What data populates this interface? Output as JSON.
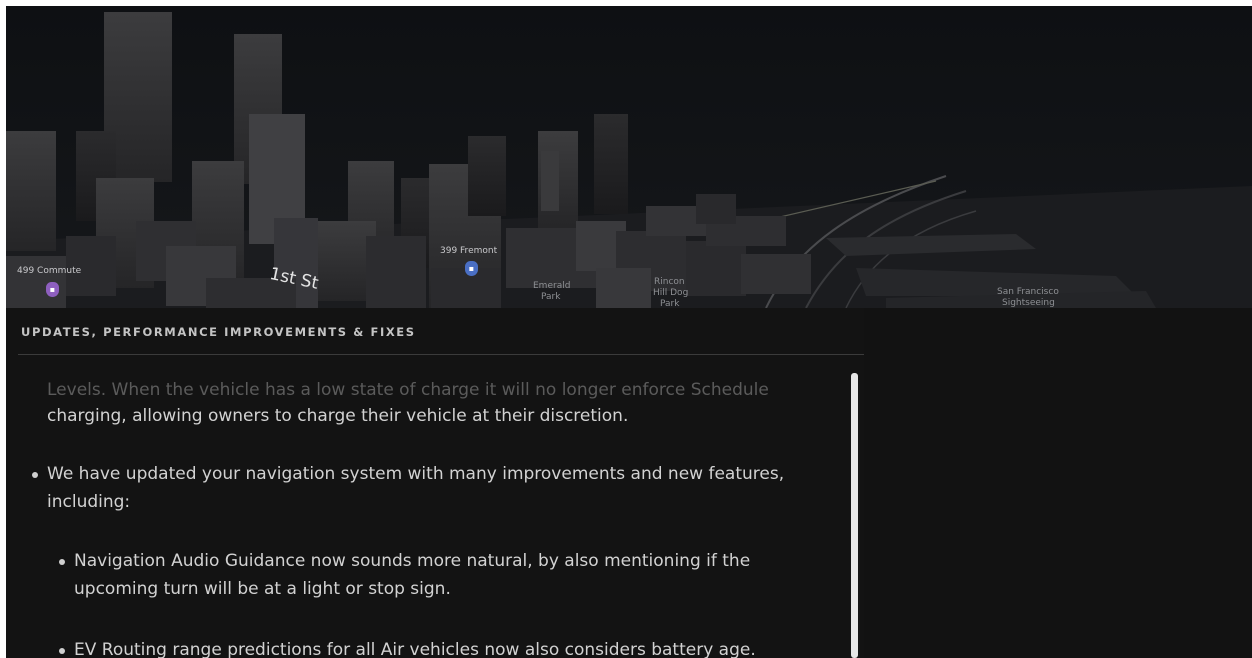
{
  "map": {
    "poi": {
      "commute": "499 Commute",
      "fremont": "399 Fremont",
      "emerald_park_line1": "Emerald",
      "emerald_park_line2": "Park",
      "rincon_line1": "Rincon",
      "rincon_line2": "Hill Dog",
      "rincon_line3": "Park",
      "sightseeing_line1": "San Francisco",
      "sightseeing_line2": "Sightseeing"
    },
    "street": "1st St",
    "icons": [
      "commute-pin-icon",
      "building-pin-icon"
    ],
    "colors": {
      "commute_pin": "#8e5fbf",
      "fremont_pin": "#4a6fc4"
    }
  },
  "panel": {
    "title": "UPDATES, PERFORMANCE IMPROVEMENTS & FIXES",
    "notes": {
      "faded_line": "Levels. When the vehicle has a low state of charge it will no longer enforce Schedule",
      "line2": "charging, allowing owners to charge their vehicle at their discretion.",
      "nav_update_line1": "We have updated your navigation system with many improvements and new features,",
      "nav_update_line2": "including:",
      "audio_line1": "Navigation Audio Guidance now sounds more natural, by also mentioning if the",
      "audio_line2": "upcoming turn will be at a light or stop sign.",
      "ev_line1": "EV Routing range predictions for all Air vehicles now also considers battery age."
    }
  }
}
